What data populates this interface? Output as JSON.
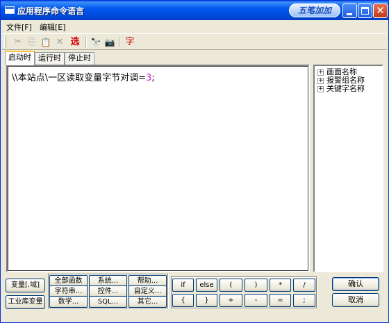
{
  "window": {
    "title": "应用程序命令语言",
    "ime_badge": "五笔加加"
  },
  "menu": [
    "文件[F]",
    "编辑[E]"
  ],
  "toolbar": {
    "cut_glyph": "✂",
    "copy_glyph": "⎘",
    "paste_glyph": "📋",
    "delete_glyph": "✕",
    "select_label": "选",
    "find_glyph": "🔭",
    "camera_glyph": "📷",
    "char_label": "字"
  },
  "tabs": [
    "启动时",
    "运行时",
    "停止时"
  ],
  "editor": {
    "code_prefix": "\\\\本站点\\一区读取变量字节对调=",
    "code_number": "3",
    "code_suffix": ";"
  },
  "tree": [
    "画面名称",
    "报警组名称",
    "关键字名称"
  ],
  "bottom": {
    "left_buttons": [
      "变量[.域]",
      "工业库变量"
    ],
    "func_buttons": [
      [
        "全部函数",
        "系统...",
        "帮助..."
      ],
      [
        "字符串...",
        "控件...",
        "自定义..."
      ],
      [
        "数学...",
        "SQL...",
        "其它..."
      ]
    ],
    "operator_rows": [
      [
        "if",
        "else",
        "(",
        ")",
        "*",
        "/"
      ],
      [
        "{",
        "}",
        "+",
        "-",
        "=",
        ";"
      ]
    ],
    "ok_label": "确认",
    "cancel_label": "取消"
  },
  "colors": {
    "titlebar": "#0058ee",
    "number_literal": "#d020d0",
    "accent_red": "#d00000"
  }
}
